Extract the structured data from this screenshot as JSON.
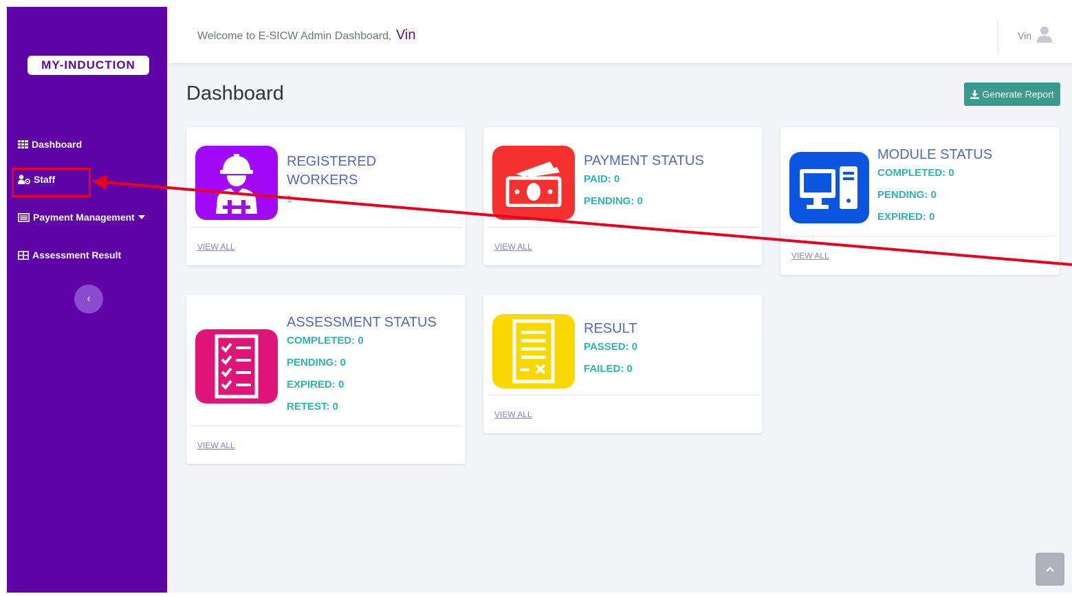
{
  "sidebar": {
    "brand": "MY-INDUCTION",
    "items": [
      {
        "label": "Dashboard"
      },
      {
        "label": "Staff"
      },
      {
        "label": "Payment Management"
      },
      {
        "label": "Assessment Result"
      }
    ],
    "collapse_glyph": "‹"
  },
  "topbar": {
    "welcome": "Welcome to E-SICW Admin Dashboard,",
    "welcome_name": "Vin",
    "user_name": "Vin"
  },
  "page": {
    "title": "Dashboard",
    "report_button": "Generate Report"
  },
  "cards": {
    "registered_workers": {
      "title_line1": "REGISTERED",
      "title_line2": "WORKERS",
      "count": "1",
      "view_all": "VIEW ALL"
    },
    "payment_status": {
      "title": "PAYMENT STATUS",
      "paid": "PAID: 0",
      "pending": "PENDING: 0",
      "view_all": "VIEW ALL"
    },
    "module_status": {
      "title": "MODULE STATUS",
      "completed": "COMPLETED: 0",
      "pending": "PENDING: 0",
      "expired": "EXPIRED: 0",
      "view_all": "VIEW ALL"
    },
    "assessment_status": {
      "title": "ASSESSMENT STATUS",
      "completed": "COMPLETED: 0",
      "pending": "PENDING: 0",
      "expired": "EXPIRED: 0",
      "retest": "RETEST: 0",
      "view_all": "VIEW ALL"
    },
    "result": {
      "title": "RESULT",
      "passed": "PASSED: 0",
      "failed": "FAILED: 0",
      "view_all": "VIEW ALL"
    }
  },
  "colors": {
    "sidebar": "#5f05a8",
    "workers_tile": "#a20af7",
    "payment_tile": "#f5312f",
    "module_tile": "#0a56e0",
    "assessment_tile": "#e0157a",
    "result_tile": "#fbd700",
    "stat_text": "#2cb5b0",
    "title_text": "#4e6ac0",
    "report_button": "#3a9b8c",
    "annotation": "#e8001c"
  },
  "icons": {
    "dashboard": "grid-icon",
    "staff": "user-gear-icon",
    "payment": "list-icon",
    "assessment": "table-icon",
    "report": "download-icon",
    "user": "user-icon",
    "workers": "construction-worker-icon",
    "payment_card": "cash-icon",
    "module": "desktop-computer-icon",
    "assessment_card": "checklist-icon",
    "result_card": "report-sheet-icon",
    "scroll_top": "chevron-up-icon"
  }
}
